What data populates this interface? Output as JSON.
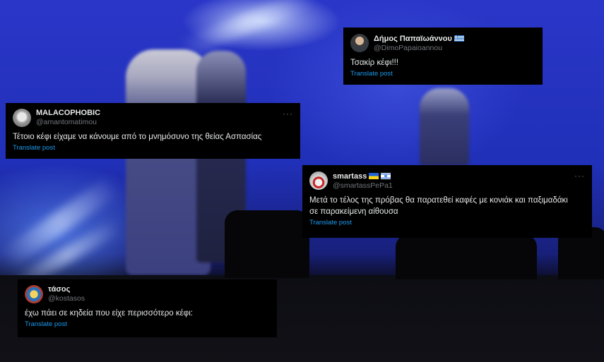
{
  "tweets": [
    {
      "name": "Δήμος Παπαϊωάννου",
      "handle": "@DimoPapaioannou",
      "flag": "greece-flag",
      "text": "Τσακίρ κέφι!!!",
      "translate": "Translate post"
    },
    {
      "name": "MALACOPHOBIC",
      "handle": "@amantomatimou",
      "text": "Τέτοιο κέφι είχαμε να κάνουμε από το μνημόσυνο της θείας Ασπασίας",
      "translate": "Translate post",
      "more": "···"
    },
    {
      "name": "smartass",
      "handle": "@smartassPePa1",
      "flags": [
        "ukraine-flag",
        "israel-flag"
      ],
      "text_line1": "Μετά το τέλος της πρόβας θα παρατεθεί καφές με κονιάκ και παξιμαδάκι",
      "text_line2": "σε παρακείμενη αίθουσα",
      "translate": "Translate post",
      "more": "···"
    },
    {
      "name": "τάσος",
      "handle": "@kostasos",
      "text": "έχω πάει σε κηδεία που είχε περισσότερο κέφι:",
      "translate": "Translate post"
    }
  ],
  "colors": {
    "card_bg": "#000000",
    "name": "#e7e9ea",
    "handle": "#71767b",
    "link": "#1d9bf0",
    "stage_blue": "#2030b8"
  }
}
